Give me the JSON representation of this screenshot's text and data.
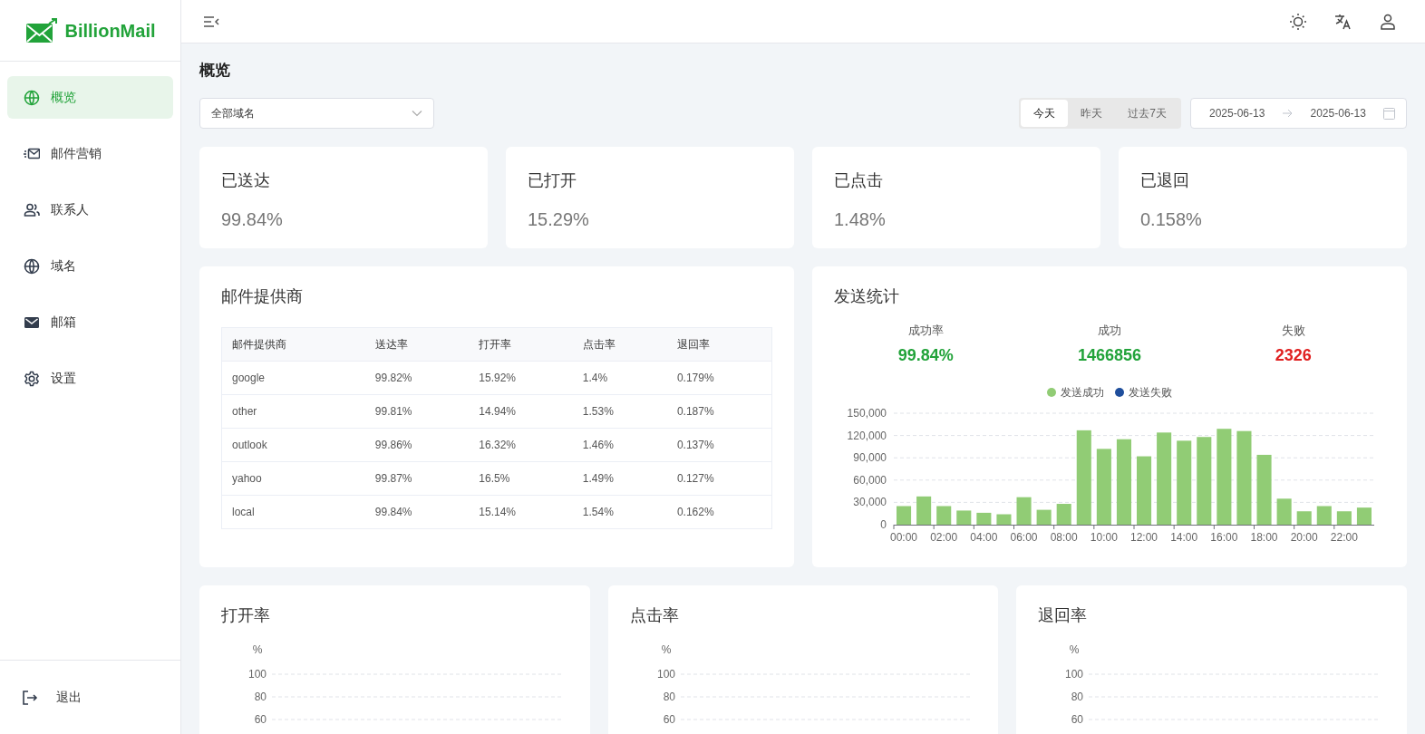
{
  "brand": {
    "name": "BillionMail"
  },
  "sidebar": {
    "items": [
      {
        "label": "概览",
        "kind": "overview",
        "selected": true
      },
      {
        "label": "邮件营销",
        "kind": "campaign",
        "selected": false
      },
      {
        "label": "联系人",
        "kind": "contacts",
        "selected": false
      },
      {
        "label": "域名",
        "kind": "domain",
        "selected": false
      },
      {
        "label": "邮箱",
        "kind": "mailbox",
        "selected": false
      },
      {
        "label": "设置",
        "kind": "settings",
        "selected": false
      }
    ],
    "footer": {
      "label": "退出"
    }
  },
  "page": {
    "title": "概览"
  },
  "filters": {
    "domain_select": {
      "value": "全部域名"
    },
    "range_tabs": [
      {
        "label": "今天",
        "selected": true
      },
      {
        "label": "昨天",
        "selected": false
      },
      {
        "label": "过去7天",
        "selected": false
      }
    ],
    "date_range": {
      "start": "2025-06-13",
      "end": "2025-06-13"
    }
  },
  "stat_cards": [
    {
      "title": "已送达",
      "value": "99.84%"
    },
    {
      "title": "已打开",
      "value": "15.29%"
    },
    {
      "title": "已点击",
      "value": "1.48%"
    },
    {
      "title": "已退回",
      "value": "0.158%"
    }
  ],
  "providers": {
    "title": "邮件提供商",
    "table": {
      "columns": [
        "邮件提供商",
        "送达率",
        "打开率",
        "点击率",
        "退回率"
      ],
      "rows": [
        [
          "google",
          "99.82%",
          "15.92%",
          "1.4%",
          "0.179%"
        ],
        [
          "other",
          "99.81%",
          "14.94%",
          "1.53%",
          "0.187%"
        ],
        [
          "outlook",
          "99.86%",
          "16.32%",
          "1.46%",
          "0.137%"
        ],
        [
          "yahoo",
          "99.87%",
          "16.5%",
          "1.49%",
          "0.127%"
        ],
        [
          "local",
          "99.84%",
          "15.14%",
          "1.54%",
          "0.162%"
        ]
      ]
    }
  },
  "send_stats": {
    "title": "发送统计",
    "summary": [
      {
        "label": "成功率",
        "value": "99.84%",
        "color": "#22a33a"
      },
      {
        "label": "成功",
        "value": "1466856",
        "color": "#22a33a"
      },
      {
        "label": "失败",
        "value": "2326",
        "color": "#e02020"
      }
    ],
    "chart_data": {
      "type": "bar",
      "categories": [
        "00:00",
        null,
        "02:00",
        null,
        "04:00",
        null,
        "06:00",
        null,
        "08:00",
        null,
        "10:00",
        null,
        "12:00",
        null,
        "14:00",
        null,
        "16:00",
        null,
        "18:00",
        null,
        "20:00",
        null,
        "22:00",
        null
      ],
      "grid": true,
      "series": [
        {
          "name": "发送成功",
          "color": "#91cc75",
          "values": [
            25000,
            38000,
            25000,
            19000,
            16000,
            14000,
            37000,
            20000,
            28000,
            127000,
            102000,
            115000,
            92000,
            124000,
            113000,
            118000,
            129000,
            126000,
            94000,
            35000,
            18000,
            25000,
            18000,
            23000
          ]
        },
        {
          "name": "发送失败",
          "color": "#1f4e9c",
          "values": [
            null,
            null,
            null,
            null,
            null,
            null,
            null,
            null,
            null,
            null,
            null,
            null,
            null,
            null,
            null,
            null,
            null,
            null,
            null,
            null,
            null,
            null,
            null,
            null
          ]
        }
      ],
      "ylim": [
        0,
        150000
      ],
      "yticks": [
        {
          "value": 0,
          "label": "0"
        },
        {
          "value": 30000,
          "label": "30,000"
        },
        {
          "value": 60000,
          "label": "60,000"
        },
        {
          "value": 90000,
          "label": "90,000"
        },
        {
          "value": 120000,
          "label": "120,000"
        },
        {
          "value": 150000,
          "label": "150,000"
        }
      ]
    }
  },
  "rate_charts": [
    {
      "title": "打开率",
      "chart_data": {
        "type": "line",
        "ylabel": "%",
        "categories": [
          null
        ],
        "ylim": [
          60,
          100
        ],
        "yticks": [
          60,
          80,
          100
        ],
        "grid": true
      }
    },
    {
      "title": "点击率",
      "chart_data": {
        "type": "line",
        "ylabel": "%",
        "categories": [
          null
        ],
        "ylim": [
          60,
          100
        ],
        "yticks": [
          60,
          80,
          100
        ],
        "grid": true
      }
    },
    {
      "title": "退回率",
      "chart_data": {
        "type": "line",
        "ylabel": "%",
        "categories": [
          null
        ],
        "ylim": [
          60,
          100
        ],
        "yticks": [
          60,
          80,
          100
        ],
        "grid": true
      }
    }
  ]
}
